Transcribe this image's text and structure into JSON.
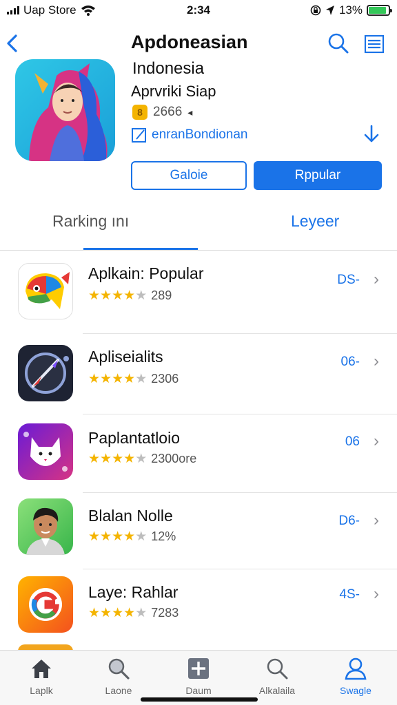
{
  "status_bar": {
    "carrier": "Uap Store",
    "time": "2:34",
    "battery": "13%",
    "battery_level": 0.9
  },
  "header": {
    "back_icon": "chevron-left-icon",
    "title": "Apdoneasian",
    "search_icon": "search-icon",
    "menu_icon": "list-menu-icon"
  },
  "app": {
    "region": "Indonesia",
    "subtitle": "Aprvriki Siap",
    "badge": "8",
    "rating_count": "2666",
    "share_mark": "◂",
    "developer": "enranBondionan",
    "developer_icon": "edit-square-icon",
    "download_icon": "download-arrow-icon",
    "btn_outline": "Galoie",
    "btn_solid": "Rppular"
  },
  "tabs": {
    "ranking": "Rarking ını",
    "layer": "Leyeer"
  },
  "items": [
    {
      "name": "Aplkain: Popular",
      "rating": 4,
      "count": "289",
      "action": "DS-",
      "icon": "rainbow-bird-icon"
    },
    {
      "name": "Apliseialits",
      "rating": 4,
      "count": "2306",
      "action": "06-",
      "icon": "compass-brush-icon"
    },
    {
      "name": "Paplantatloio",
      "rating": 4,
      "count": "2300ore",
      "action": "06",
      "icon": "cat-face-icon"
    },
    {
      "name": "Blalan Nolle",
      "rating": 4,
      "count": "12%",
      "action": "D6-",
      "icon": "man-portrait-icon"
    },
    {
      "name": "Laye: Rahlar",
      "rating": 4,
      "count": "7283",
      "action": "4S-",
      "icon": "g-logo-icon"
    }
  ],
  "tab_bar": [
    {
      "label": "Laplk",
      "icon": "home-icon",
      "active": false
    },
    {
      "label": "Laone",
      "icon": "search-icon",
      "active": false
    },
    {
      "label": "Daum",
      "icon": "plus-square-icon",
      "active": false
    },
    {
      "label": "Alkalaila",
      "icon": "search-icon",
      "active": false
    },
    {
      "label": "Swagle",
      "icon": "person-icon",
      "active": true
    }
  ],
  "colors": {
    "accent": "#1a73e8",
    "star": "#f4b400",
    "battery": "#34c759"
  }
}
